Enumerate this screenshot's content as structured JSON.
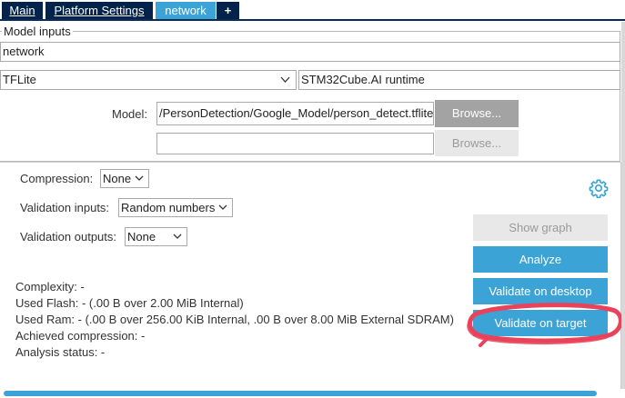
{
  "tabs": [
    {
      "label": "Main"
    },
    {
      "label": "Platform Settings"
    },
    {
      "label": "network"
    },
    {
      "label": "+"
    }
  ],
  "model_inputs": {
    "title": "Model inputs",
    "name_value": "network",
    "framework_value": "TFLite",
    "runtime_value": "STM32Cube.AI runtime",
    "model_label": "Model:",
    "model_path": "/PersonDetection/Google_Model/person_detect.tflite",
    "browse_label": "Browse...",
    "second_path": "",
    "browse2_label": "Browse..."
  },
  "settings": {
    "compression_label": "Compression:",
    "compression_value": "None",
    "validation_inputs_label": "Validation inputs:",
    "validation_inputs_value": "Random numbers",
    "validation_outputs_label": "Validation outputs:",
    "validation_outputs_value": "None"
  },
  "actions": {
    "show_graph": "Show graph",
    "analyze": "Analyze",
    "validate_desktop": "Validate on desktop",
    "validate_target": "Validate on target"
  },
  "info": {
    "complexity": "Complexity: -",
    "used_flash": "Used Flash: - (.00 B over 2.00 MiB Internal)",
    "used_ram": "Used Ram: - (.00 B over 256.00 KiB Internal, .00 B over 8.00 MiB External SDRAM)",
    "achieved_compression": "Achieved compression: -",
    "analysis_status": "Analysis status: -"
  },
  "icons": {
    "settings": "gear-icon",
    "dropdown": "chevron-down-icon"
  },
  "colors": {
    "tab_dark": "#03234b",
    "accent_blue": "#3ca3d7",
    "button_gray": "#a3a3a3",
    "annotation_red": "#e8435a"
  }
}
